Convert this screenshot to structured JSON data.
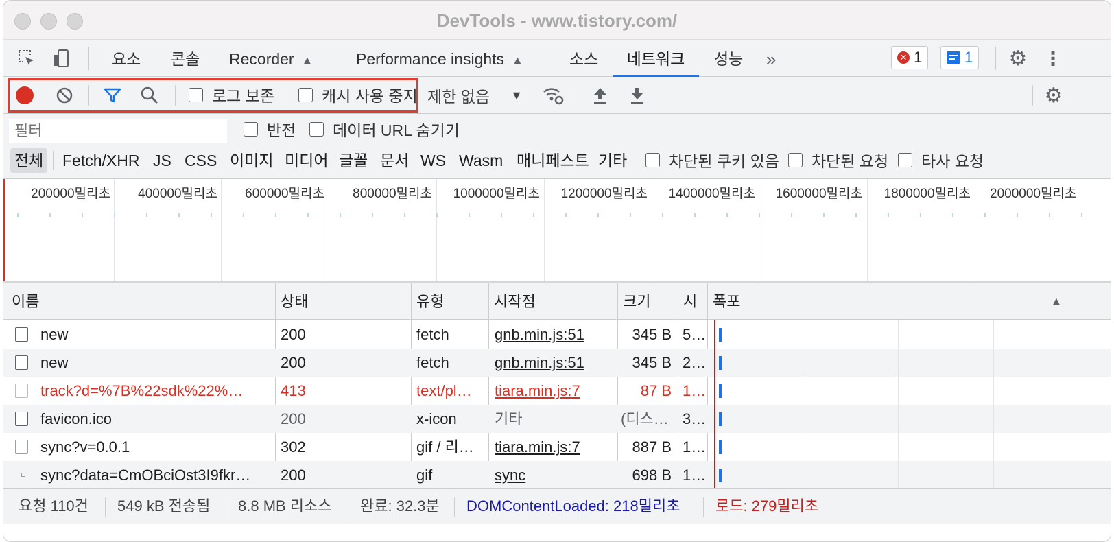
{
  "window": {
    "title": "DevTools - www.tistory.com/"
  },
  "tabs": [
    {
      "label": "요소"
    },
    {
      "label": "콘솔"
    },
    {
      "label": "Recorder"
    },
    {
      "label": "Performance insights"
    },
    {
      "label": "소스"
    },
    {
      "label": "네트워크",
      "active": true
    },
    {
      "label": "성능"
    }
  ],
  "badges": {
    "errors": "1",
    "messages": "1"
  },
  "toolbar": {
    "preserve_log": "로그 보존",
    "disable_cache": "캐시 사용 중지",
    "throttling": "제한 없음"
  },
  "filter": {
    "placeholder": "필터",
    "invert": "반전",
    "hide_data_urls": "데이터 URL 숨기기",
    "types": [
      "전체",
      "Fetch/XHR",
      "JS",
      "CSS",
      "이미지",
      "미디어",
      "글꼴",
      "문서",
      "WS",
      "Wasm",
      "매니페스트",
      "기타"
    ],
    "blocked_cookies": "차단된 쿠키 있음",
    "blocked_requests": "차단된 요청",
    "third_party": "타사 요청"
  },
  "overview": {
    "labels": [
      "200000밀리초",
      "400000밀리초",
      "600000밀리초",
      "800000밀리초",
      "1000000밀리초",
      "1200000밀리초",
      "1400000밀리초",
      "1600000밀리초",
      "1800000밀리초",
      "2000000밀리초"
    ]
  },
  "table": {
    "columns": {
      "name": "이름",
      "status": "상태",
      "type": "유형",
      "initiator": "시작점",
      "size": "크기",
      "time": "시",
      "waterfall": "폭포"
    },
    "rows": [
      {
        "name": "new",
        "status": "200",
        "type": "fetch",
        "initiator": "gnb.min.js:51",
        "size": "345 B",
        "time": "5…"
      },
      {
        "name": "new",
        "status": "200",
        "type": "fetch",
        "initiator": "gnb.min.js:51",
        "size": "345 B",
        "time": "2…"
      },
      {
        "name": "track?d=%7B%22sdk%22%…",
        "status": "413",
        "type": "text/pl…",
        "initiator": "tiara.min.js:7",
        "size": "87 B",
        "time": "1…",
        "error": true
      },
      {
        "name": "favicon.ico",
        "status": "200",
        "type": "x-icon",
        "initiator": "기타",
        "size": "(디스…",
        "time": "3…"
      },
      {
        "name": "sync?v=0.0.1",
        "status": "302",
        "type": "gif / 리…",
        "initiator": "tiara.min.js:7",
        "size": "887 B",
        "time": "1…"
      },
      {
        "name": "sync?data=CmOBciOst3I9fkr…",
        "status": "200",
        "type": "gif",
        "initiator": "sync",
        "size": "698 B",
        "time": "1…"
      }
    ]
  },
  "status": {
    "requests": "요청 110건",
    "transferred": "549 kB 전송됨",
    "resources": "8.8 MB 리소스",
    "finish": "완료: 32.3분",
    "dcl": "DOMContentLoaded: 218밀리초",
    "load": "로드: 279밀리초"
  },
  "colors": {
    "accent": "#1a73e8",
    "error": "#d93025",
    "dcl": "#1a1aa6",
    "load": "#c5221f",
    "highlight": "#e53b2c"
  }
}
